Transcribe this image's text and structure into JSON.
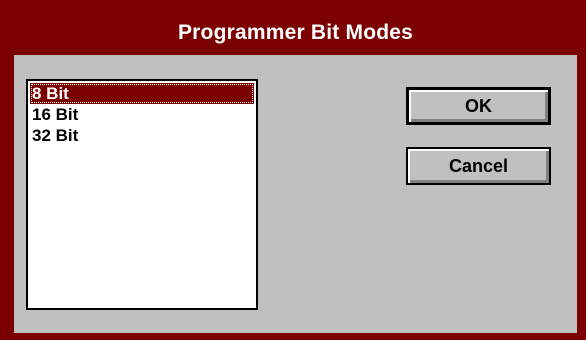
{
  "dialog": {
    "title": "Programmer Bit Modes"
  },
  "listbox": {
    "items": [
      {
        "label": "8 Bit",
        "selected": true
      },
      {
        "label": "16 Bit",
        "selected": false
      },
      {
        "label": "32 Bit",
        "selected": false
      }
    ]
  },
  "buttons": {
    "ok_label": "OK",
    "cancel_label": "Cancel"
  },
  "colors": {
    "title_bar": "#7b0000",
    "dialog_face": "#c0c0c0",
    "selection": "#7b0000"
  }
}
